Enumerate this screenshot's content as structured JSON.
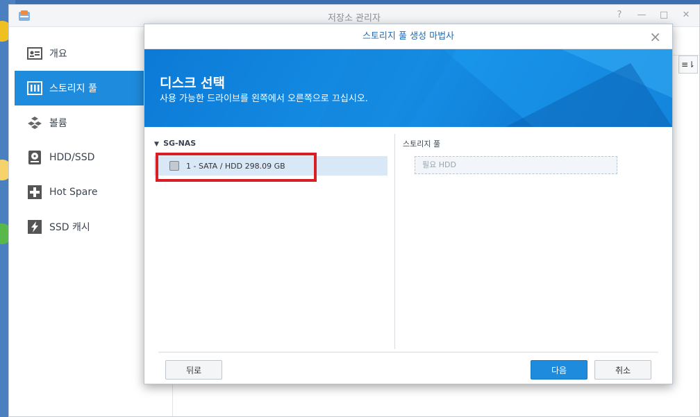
{
  "app": {
    "title": "저장소 관리자"
  },
  "window_controls": {
    "help": "?",
    "minimize": "—",
    "maximize": "□",
    "close": "✕"
  },
  "sidebar": {
    "items": [
      {
        "label": "개요",
        "icon": "overview-icon"
      },
      {
        "label": "스토리지 풀",
        "icon": "storage-pool-icon",
        "active": true
      },
      {
        "label": "볼륨",
        "icon": "volume-icon"
      },
      {
        "label": "HDD/SSD",
        "icon": "hdd-icon"
      },
      {
        "label": "Hot Spare",
        "icon": "hot-spare-icon"
      },
      {
        "label": "SSD 캐시",
        "icon": "ssd-cache-icon"
      }
    ]
  },
  "content": {
    "sort_icon": "≡⇂"
  },
  "wizard": {
    "title": "스토리지 풀 생성 마법사",
    "banner_title": "디스크 선택",
    "banner_subtitle": "사용 가능한 드라이브를 왼쪽에서 오른쪽으로 끄십시오.",
    "left_pane": {
      "host": "SG-NAS",
      "disks": [
        {
          "label": "1 - SATA / HDD 298.09 GB"
        }
      ]
    },
    "right_pane": {
      "label": "스토리지 풀",
      "placeholder": "필요 HDD"
    },
    "buttons": {
      "back": "뒤로",
      "next": "다음",
      "cancel": "취소"
    }
  },
  "colors": {
    "accent": "#1e8bdc",
    "annotation": "#d81f26"
  }
}
